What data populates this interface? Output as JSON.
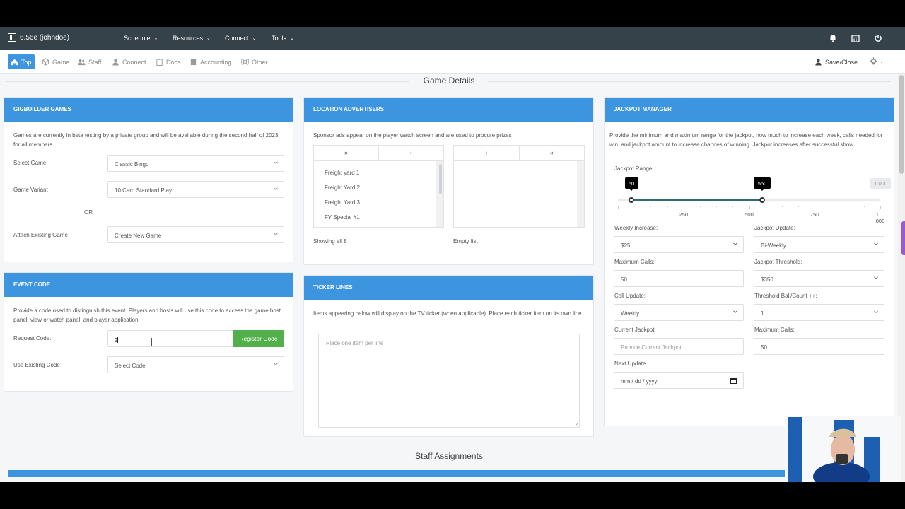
{
  "app": {
    "title": "6.56e (johndoe)"
  },
  "topnav": {
    "menus": [
      "Schedule",
      "Resources",
      "Connect",
      "Tools"
    ],
    "icons": [
      "bell-icon",
      "calendar-icon",
      "power-icon"
    ]
  },
  "subnav": {
    "tabs": [
      "Top",
      "Game",
      "Staff",
      "Connect",
      "Docs",
      "Accounting",
      "Other"
    ],
    "save_close": "Save/Close"
  },
  "sections": {
    "game_details": "Game Details",
    "staff_assignments": "Staff Assignments"
  },
  "gigbuilder": {
    "header": "GIGBUILDER GAMES",
    "description": "Games are currently in beta testing by a private group and will be available during the second half of 2023 for all members.",
    "select_game_label": "Select Game",
    "select_game_value": "Classic Bingo",
    "variant_label": "Game Variant",
    "variant_value": "10 Card Standard Play",
    "or": "OR",
    "attach_label": "Attach Existing Game",
    "attach_value": "Create New Game"
  },
  "event_code": {
    "header": "EVENT CODE",
    "description": "Provide a code used to distinguish this event. Players and hosts will use this code to access the game host panel, view or watch panel, and player application.",
    "request_label": "Request Code:",
    "request_value": "2",
    "register_button": "Register Code",
    "existing_label": "Use Existing Code",
    "existing_value": "Select Code"
  },
  "advertisers": {
    "header": "LOCATION ADVERTISERS",
    "description": "Sponsor ads appear on the player watch screen and are used to procure prizes",
    "left_buttons": [
      "»",
      "›"
    ],
    "right_buttons": [
      "‹",
      "«"
    ],
    "items": [
      "Freight yard 1",
      "Freight Yard 2",
      "Freight Yard 3",
      "FY Special #1"
    ],
    "left_status": "Showing all 8",
    "right_status": "Empty list"
  },
  "ticker": {
    "header": "TICKER LINES",
    "description": "Items appearing below will display on the TV ticker (when applicable). Place each ticker item on its own line.",
    "placeholder": "Place one item per line"
  },
  "jackpot": {
    "header": "JACKPOT MANAGER",
    "description": "Provide the minimum and maximum range for the jackpot, how much to increase each week, calls needed for win, and jackpot amount to increase chances of winning. Jackpot increases after successful show.",
    "range_label": "Jackpot Range:",
    "range_min": 0,
    "range_max": 1000,
    "range_low": 50,
    "range_high": 550,
    "low_label": "50",
    "high_label": "550",
    "max_label": "1 000",
    "ticks": [
      "0",
      "250",
      "500",
      "750",
      "1 000"
    ],
    "weekly_increase_label": "Weekly Increase:",
    "weekly_increase_value": "$25",
    "jackpot_update_label": "Jackpot Update:",
    "jackpot_update_value": "Bi-Weekly",
    "max_calls_label": "Maximum Calls:",
    "max_calls_value": "50",
    "threshold_label": "Jackpot Threshold:",
    "threshold_value": "$350",
    "call_update_label": "Call Update:",
    "call_update_value": "Weekly",
    "threshold_ball_label": "Threshold Ball/Count ++:",
    "threshold_ball_value": "1",
    "current_label": "Current Jackpot:",
    "current_placeholder": "Provide Current Jackpot",
    "max_calls2_label": "Maximum Calls:",
    "max_calls2_value": "50",
    "next_update_label": "Next Update",
    "next_update_placeholder": "mm / dd / yyyy"
  },
  "colors": {
    "accent": "#3d95e0",
    "nav": "#36424a",
    "success": "#52b04a",
    "slider": "#2d6c75"
  }
}
